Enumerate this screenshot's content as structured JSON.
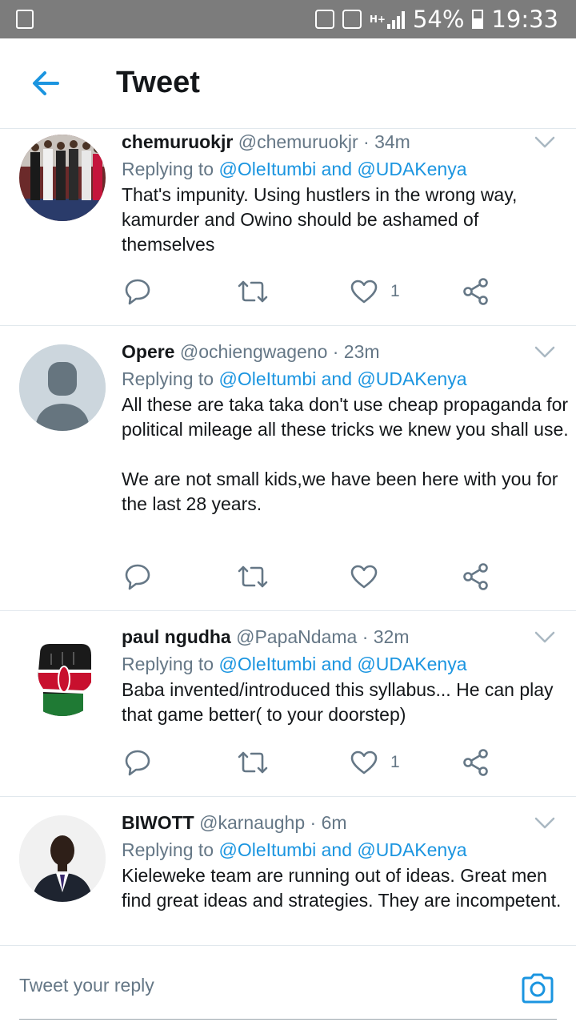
{
  "status_bar": {
    "battery": "54%",
    "time": "19:33",
    "network": "H+"
  },
  "header": {
    "title": "Tweet",
    "back_icon": "arrow-left-icon"
  },
  "tweets": [
    {
      "name": "chemuruokjr",
      "handle": "@chemuruokjr",
      "time": "· 34m",
      "replying_prefix": "Replying to",
      "replying_to": "@OleItumbi and @UDAKenya",
      "text": "That's impunity. Using hustlers in the wrong way, kamurder and Owino should be ashamed of themselves",
      "likes": "1"
    },
    {
      "name": "Opere",
      "handle": "@ochiengwageno",
      "time": "· 23m",
      "replying_prefix": "Replying to",
      "replying_to": "@OleItumbi and @UDAKenya",
      "text": "All these are taka taka don't use cheap propaganda for political mileage all these tricks we knew you shall use.\n\nWe are not small kids,we have been here with you for the last 28 years.",
      "likes": ""
    },
    {
      "name": "paul ngudha",
      "handle": "@PapaNdama",
      "time": "· 32m",
      "replying_prefix": "Replying to",
      "replying_to": "@OleItumbi and @UDAKenya",
      "text": "Baba invented/introduced this syllabus... He can play that game better( to your doorstep)",
      "likes": "1"
    },
    {
      "name": "BIWOTT",
      "handle": "@karnaughp",
      "time": "· 6m",
      "replying_prefix": "Replying to",
      "replying_to": "@OleItumbi and @UDAKenya",
      "text": "Kieleweke team are running out of ideas. Great men find great ideas and strategies. They are incompetent.",
      "likes": ""
    }
  ],
  "reply_bar": {
    "placeholder": "Tweet your reply",
    "camera_icon": "camera-icon"
  },
  "colors": {
    "accent": "#1b95e0",
    "text": "#14171a",
    "secondary": "#657786",
    "divider": "#e1e8ed",
    "status_bar": "#7c7c7c"
  }
}
